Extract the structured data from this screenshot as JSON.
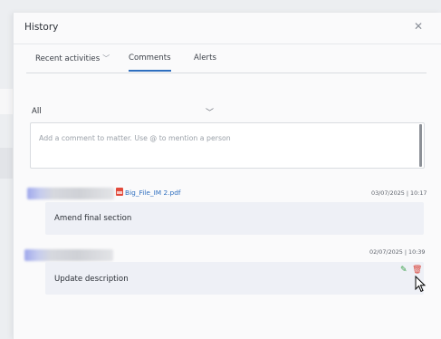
{
  "panel": {
    "title": "History",
    "close_icon": "close-icon"
  },
  "tabs": [
    {
      "label": "Recent activities",
      "has_dropdown": true,
      "active": false
    },
    {
      "label": "Comments",
      "active": true
    },
    {
      "label": "Alerts",
      "active": false
    }
  ],
  "filter": {
    "selected": "All"
  },
  "comment_input": {
    "placeholder": "Add a comment to matter. Use @ to mention a person"
  },
  "comments": [
    {
      "attachment": "Big_File_IM 2.pdf",
      "timestamp": "03/07/2025 | 10:17",
      "text": "Amend final section"
    },
    {
      "timestamp": "02/07/2025 | 10:39",
      "text": "Update description"
    }
  ],
  "colors": {
    "accent": "#2f6fbf",
    "edit": "#3aa14a",
    "delete": "#d9443a"
  }
}
